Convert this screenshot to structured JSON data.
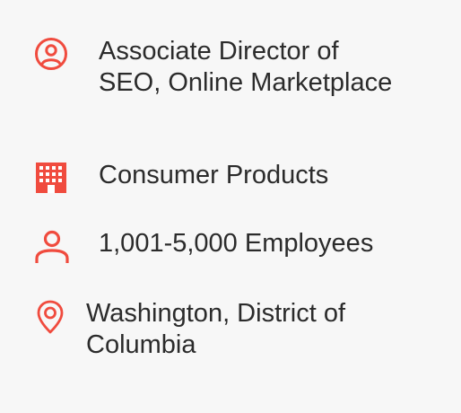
{
  "accent_color": "#f04b3e",
  "profile": {
    "items": [
      {
        "icon": "user-circle-icon",
        "text": "Associate Director of SEO, Online Marketplace"
      },
      {
        "icon": "building-icon",
        "text": "Consumer Products"
      },
      {
        "icon": "person-icon",
        "text": "1,001-5,000 Employees"
      },
      {
        "icon": "location-pin-icon",
        "text": "Washington, District of Columbia"
      }
    ]
  }
}
